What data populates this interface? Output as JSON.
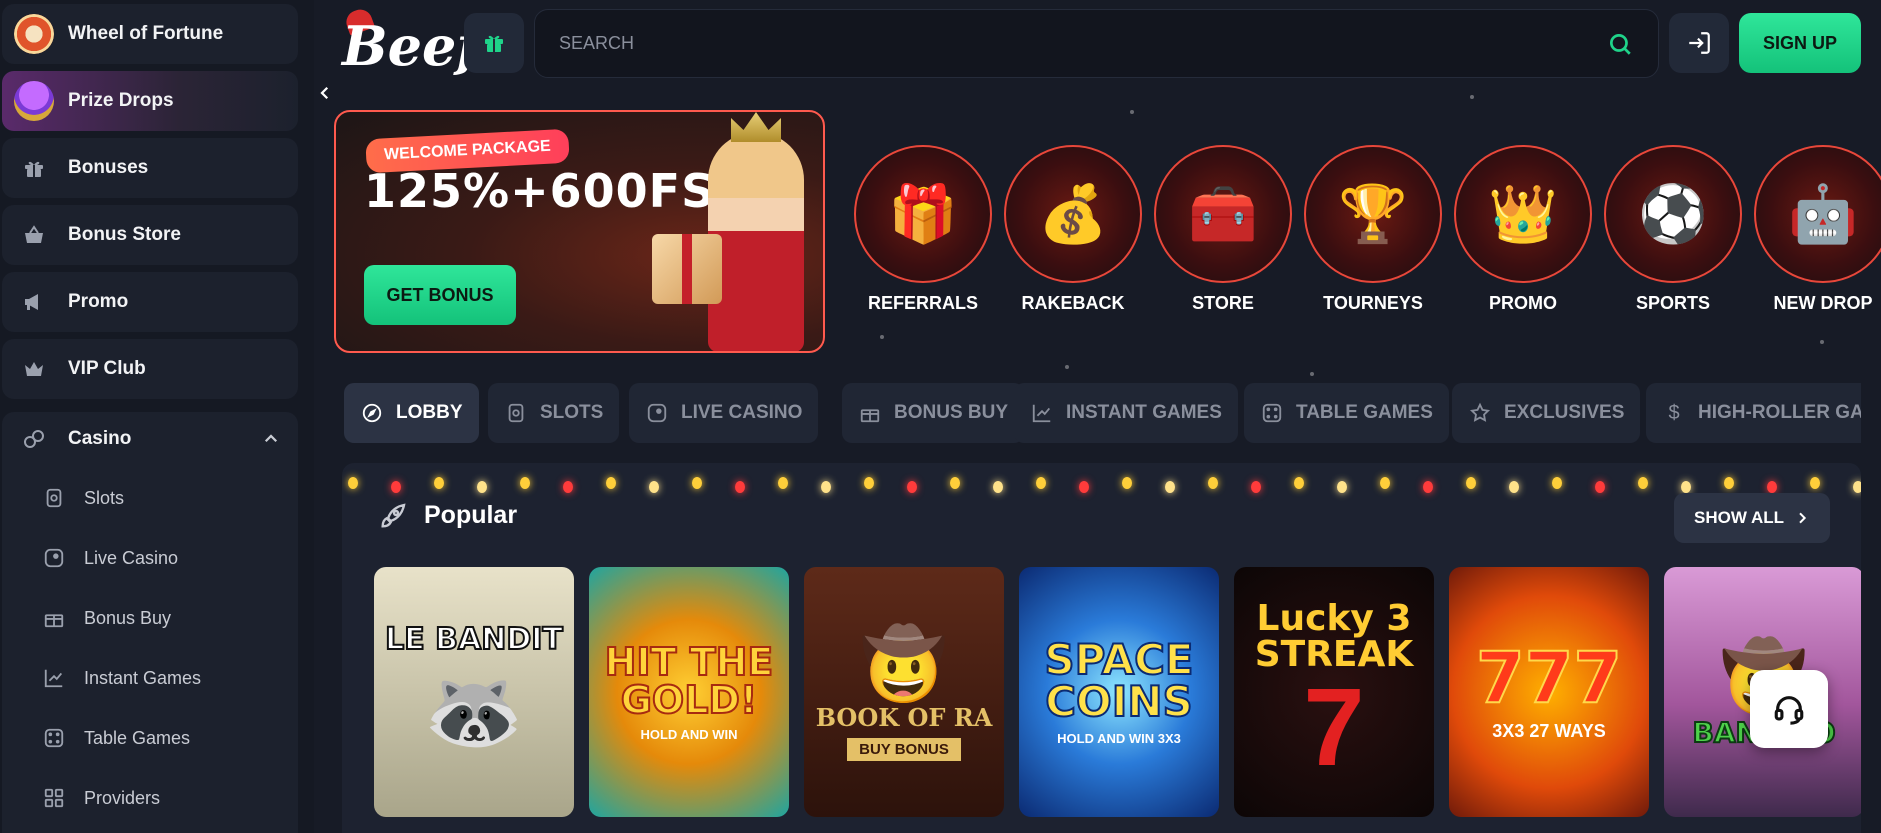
{
  "sidebar": {
    "wheel_label": "Wheel of Fortune",
    "prize_label": "Prize Drops",
    "items": [
      {
        "label": "Bonuses"
      },
      {
        "label": "Bonus Store"
      },
      {
        "label": "Promo"
      },
      {
        "label": "VIP Club"
      }
    ],
    "casino_label": "Casino",
    "casino_sub": [
      {
        "label": "Slots"
      },
      {
        "label": "Live Casino"
      },
      {
        "label": "Bonus Buy"
      },
      {
        "label": "Instant Games"
      },
      {
        "label": "Table Games"
      },
      {
        "label": "Providers"
      }
    ]
  },
  "header": {
    "logo_text": "Beef",
    "search_placeholder": "SEARCH",
    "signup_label": "SIGN UP"
  },
  "banner": {
    "tag": "WELCOME PACKAGE",
    "headline": "125%+600FS",
    "button": "GET BONUS"
  },
  "categories": [
    {
      "label": "REFERRALS",
      "icon": "🎁"
    },
    {
      "label": "RAKEBACK",
      "icon": "💰"
    },
    {
      "label": "STORE",
      "icon": "🧰"
    },
    {
      "label": "TOURNEYS",
      "icon": "🏆"
    },
    {
      "label": "PROMO",
      "icon": "👑"
    },
    {
      "label": "SPORTS",
      "icon": "⚽"
    },
    {
      "label": "NEW DROP",
      "icon": "🤖"
    }
  ],
  "tabs": [
    {
      "label": "LOBBY"
    },
    {
      "label": "SLOTS"
    },
    {
      "label": "LIVE CASINO"
    },
    {
      "label": "BONUS BUY"
    },
    {
      "label": "INSTANT GAMES"
    },
    {
      "label": "TABLE GAMES"
    },
    {
      "label": "EXCLUSIVES"
    },
    {
      "label": "HIGH-ROLLER GAMES"
    }
  ],
  "popular": {
    "title": "Popular",
    "show_all": "SHOW ALL",
    "games": [
      {
        "title": "LE BANDIT",
        "sub": ""
      },
      {
        "title": "HIT THE GOLD!",
        "sub": "HOLD AND WIN"
      },
      {
        "title": "BOOK OF RA",
        "sub": "BUY BONUS"
      },
      {
        "title": "SPACE COINS",
        "sub": "HOLD AND WIN 3X3"
      },
      {
        "title": "Lucky 3 STREAK",
        "sub": "7"
      },
      {
        "title": "777",
        "sub": "3X3 27 WAYS"
      },
      {
        "title": "BANDITO",
        "sub": ""
      }
    ]
  },
  "colors": {
    "accent_green": "#1fd38a",
    "accent_red": "#ff5a4e",
    "bg": "#171b26"
  }
}
